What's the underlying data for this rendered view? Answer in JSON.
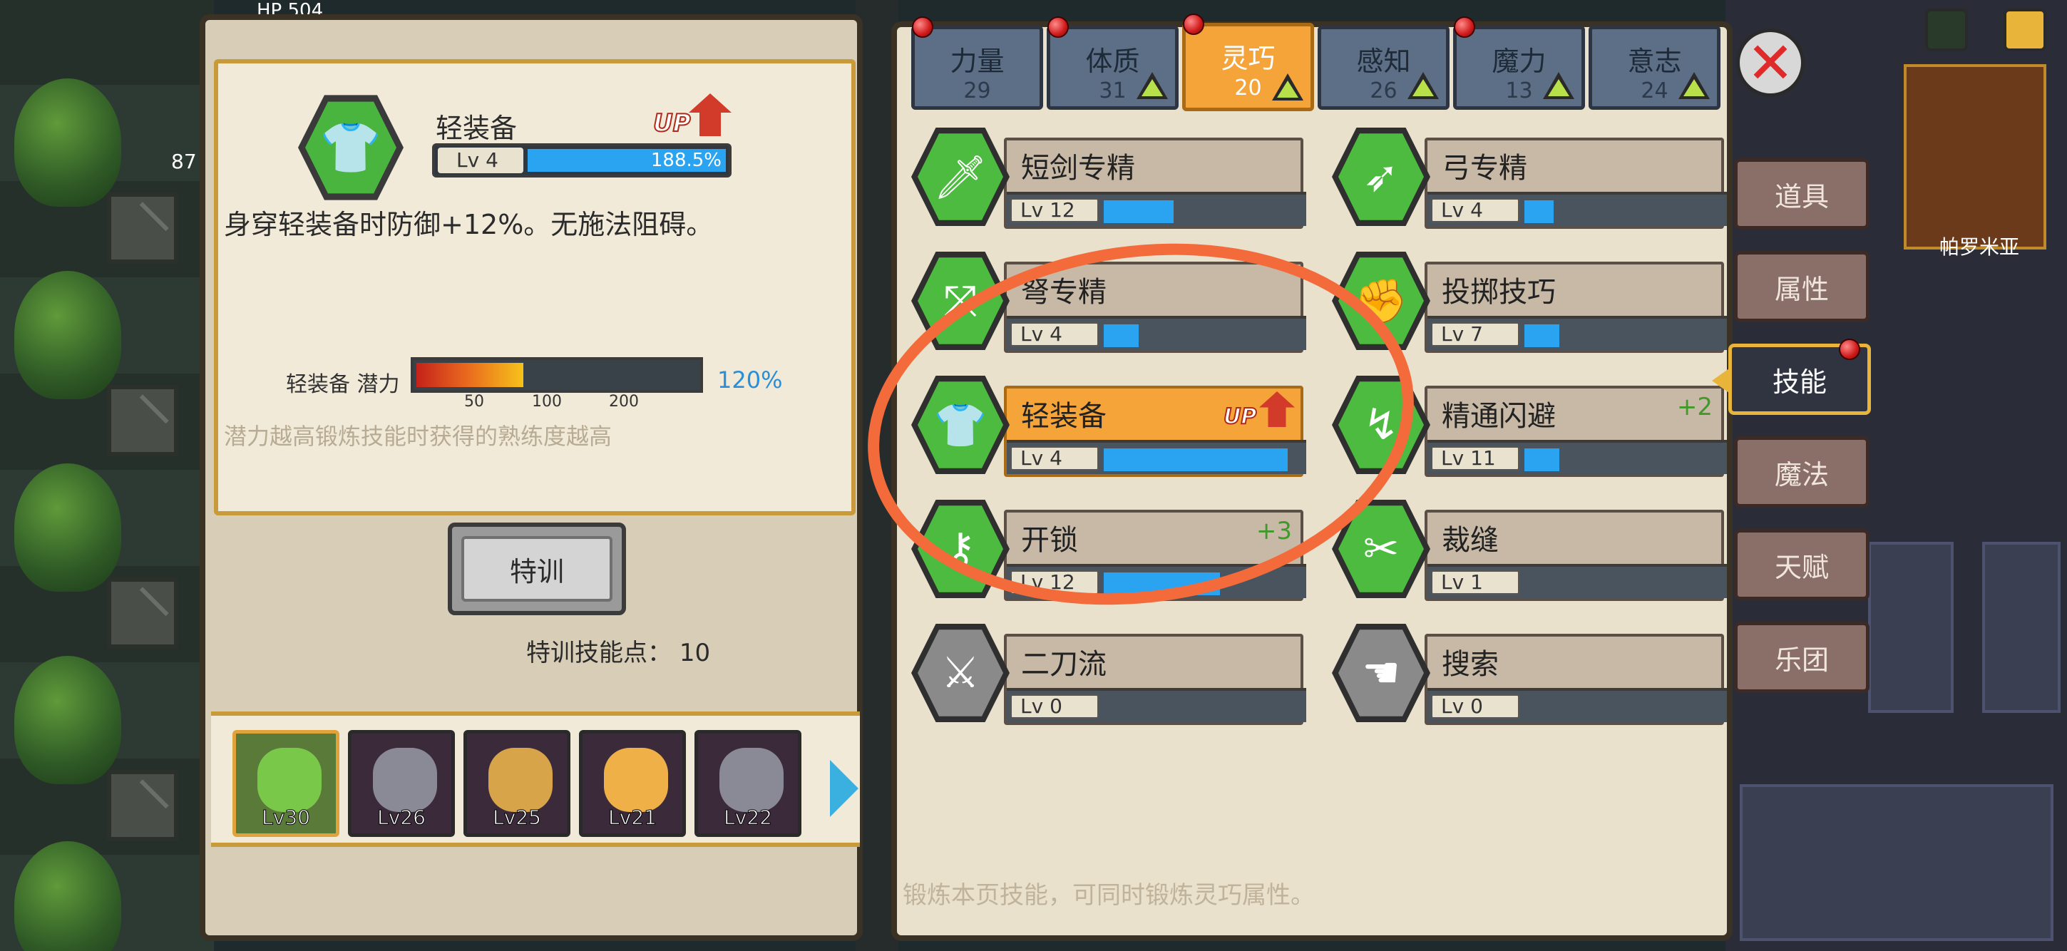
{
  "hud": {
    "hp_label": "HP",
    "hp_value": "504",
    "gem_count": "87",
    "location": "帕罗米亚"
  },
  "detail": {
    "skill_name": "轻装备",
    "up_label": "UP",
    "level": "Lv 4",
    "progress_text": "188.5%",
    "progress": 1.0,
    "description": "身穿轻装备时防御+12%。无施法阻碍。",
    "potential_label": "轻装备 潜力",
    "potential_fraction": 0.38,
    "potential_ticks": [
      "50",
      "100",
      "200"
    ],
    "potential_percent": "120%",
    "hint": "潜力越高锻炼技能时获得的熟练度越高",
    "train_button": "特训",
    "train_points_label": "特训技能点：",
    "train_points_value": "10"
  },
  "party": [
    {
      "level": "Lv30",
      "active": true,
      "color": "#7ac84a"
    },
    {
      "level": "Lv26",
      "active": false,
      "color": "#8a8a96"
    },
    {
      "level": "Lv25",
      "active": false,
      "color": "#d8a44a"
    },
    {
      "level": "Lv21",
      "active": false,
      "color": "#f0b048"
    },
    {
      "level": "Lv22",
      "active": false,
      "color": "#8a8a96"
    }
  ],
  "stat_tabs": [
    {
      "name": "力量",
      "value": "29",
      "dot": true,
      "up": false,
      "active": false
    },
    {
      "name": "体质",
      "value": "31",
      "dot": true,
      "up": true,
      "active": false
    },
    {
      "name": "灵巧",
      "value": "20",
      "dot": true,
      "up": true,
      "active": true
    },
    {
      "name": "感知",
      "value": "26",
      "dot": false,
      "up": true,
      "active": false
    },
    {
      "name": "魔力",
      "value": "13",
      "dot": true,
      "up": true,
      "active": false
    },
    {
      "name": "意志",
      "value": "24",
      "dot": false,
      "up": true,
      "active": false
    }
  ],
  "skills": [
    {
      "name": "短剑专精",
      "level": "Lv 12",
      "progress": 0.36,
      "icon": "dagger-icon",
      "glyph": "🗡",
      "bonus": "",
      "up": false,
      "selected": false,
      "gray": false
    },
    {
      "name": "弓专精",
      "level": "Lv 4",
      "progress": 0.15,
      "icon": "bow-icon",
      "glyph": "➶",
      "bonus": "",
      "up": false,
      "selected": false,
      "gray": false
    },
    {
      "name": "弩专精",
      "level": "Lv 4",
      "progress": 0.18,
      "icon": "crossbow-icon",
      "glyph": "⤧",
      "bonus": "",
      "up": false,
      "selected": false,
      "gray": false
    },
    {
      "name": "投掷技巧",
      "level": "Lv 7",
      "progress": 0.18,
      "icon": "throw-icon",
      "glyph": "✊",
      "bonus": "",
      "up": false,
      "selected": false,
      "gray": false
    },
    {
      "name": "轻装备",
      "level": "Lv 4",
      "progress": 0.95,
      "icon": "light-armor-icon",
      "glyph": "👕",
      "bonus": "",
      "up": true,
      "selected": true,
      "gray": false
    },
    {
      "name": "精通闪避",
      "level": "Lv 11",
      "progress": 0.18,
      "icon": "evade-icon",
      "glyph": "↯",
      "bonus": "+2",
      "up": false,
      "selected": false,
      "gray": false
    },
    {
      "name": "开锁",
      "level": "Lv 12",
      "progress": 0.6,
      "icon": "key-icon",
      "glyph": "⚷",
      "bonus": "+3",
      "up": false,
      "selected": false,
      "gray": false
    },
    {
      "name": "裁缝",
      "level": "Lv 1",
      "progress": 0.0,
      "icon": "scissors-icon",
      "glyph": "✂",
      "bonus": "",
      "up": false,
      "selected": false,
      "gray": false
    },
    {
      "name": "二刀流",
      "level": "Lv 0",
      "progress": 0.0,
      "icon": "dual-wield-icon",
      "glyph": "⚔",
      "bonus": "",
      "up": false,
      "selected": false,
      "gray": true
    },
    {
      "name": "搜索",
      "level": "Lv 0",
      "progress": 0.0,
      "icon": "search-hand-icon",
      "glyph": "☚",
      "bonus": "",
      "up": false,
      "selected": false,
      "gray": true
    }
  ],
  "footer_note": "锻炼本页技能，可同时锻炼灵巧属性。",
  "side_menu": [
    {
      "label": "道具",
      "active": false,
      "dot": false
    },
    {
      "label": "属性",
      "active": false,
      "dot": false
    },
    {
      "label": "技能",
      "active": true,
      "dot": true
    },
    {
      "label": "魔法",
      "active": false,
      "dot": false
    },
    {
      "label": "天赋",
      "active": false,
      "dot": false
    },
    {
      "label": "乐团",
      "active": false,
      "dot": false
    }
  ],
  "colors": {
    "accent": "#f5a43a",
    "progress": "#2aa3f0",
    "annotation": "#f36b3b",
    "skill_green": "#4cbb3f"
  }
}
